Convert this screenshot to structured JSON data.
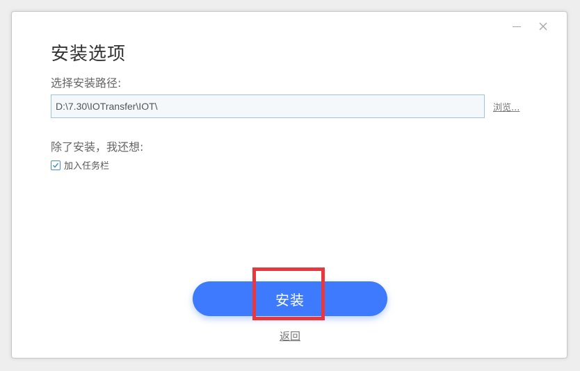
{
  "window": {
    "title": "安装选项"
  },
  "path": {
    "label": "选择安装路径:",
    "value": "D:\\7.30\\IOTransfer\\IOT\\",
    "browse_label": "浏览..."
  },
  "options": {
    "label": "除了安装，我还想:",
    "taskbar_label": "加入任务栏",
    "taskbar_checked": true
  },
  "actions": {
    "install_label": "安装",
    "back_label": "返回"
  },
  "colors": {
    "accent": "#3d7afe",
    "highlight": "#e8383d"
  },
  "icons": {
    "minimize": "minimize-icon",
    "close": "close-icon",
    "check": "check-icon"
  }
}
